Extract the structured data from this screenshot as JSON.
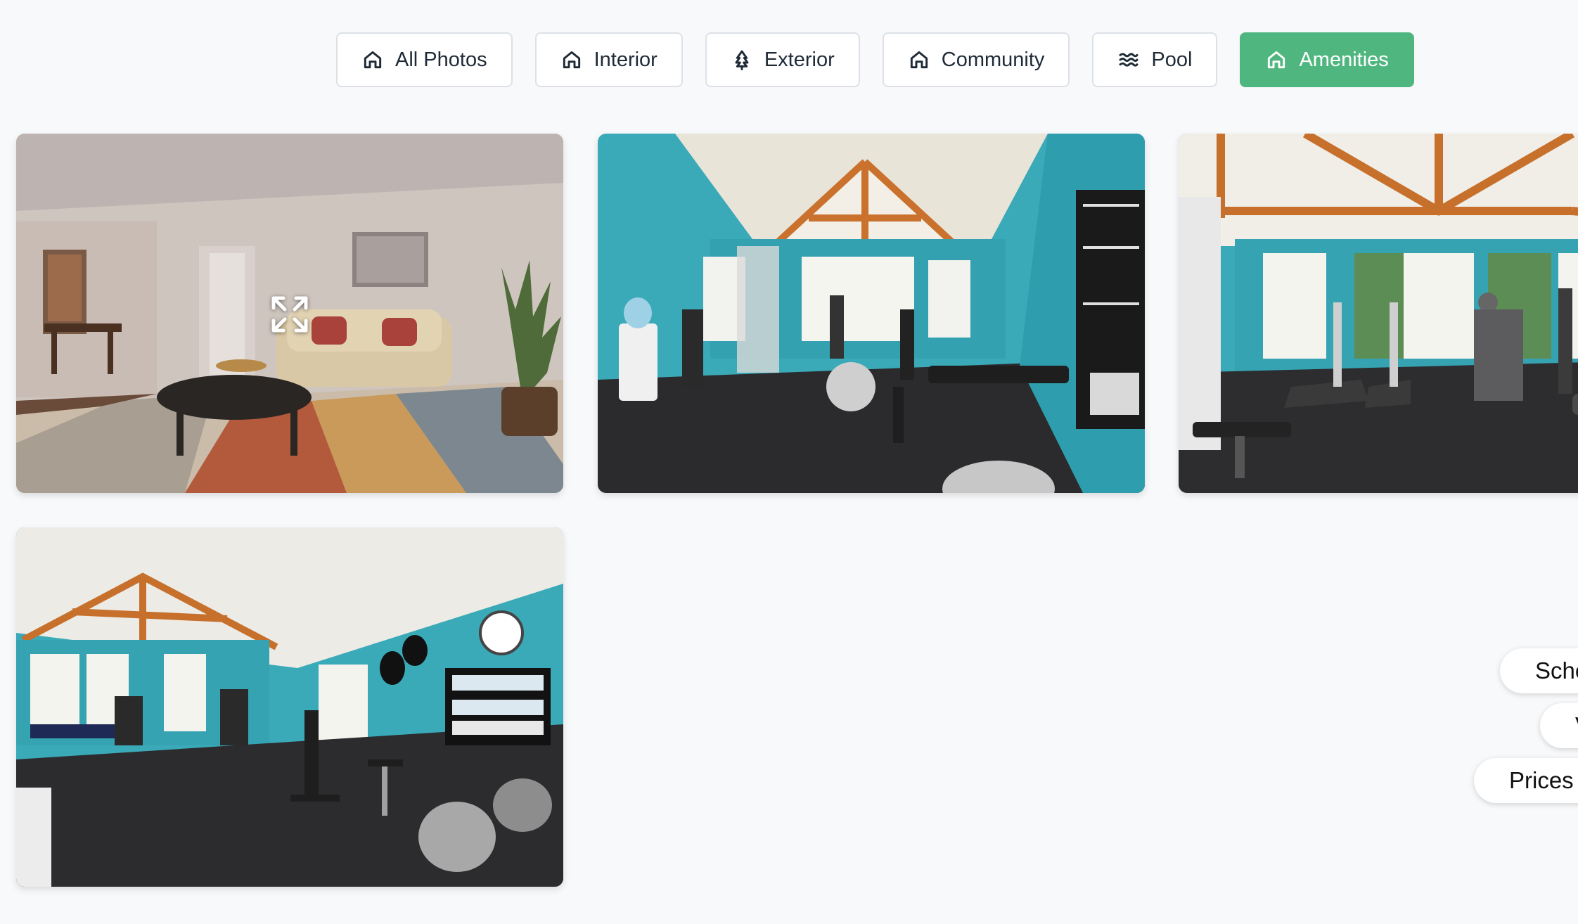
{
  "filters": {
    "tabs": [
      {
        "label": "All Photos",
        "icon": "home-icon",
        "active": false
      },
      {
        "label": "Interior",
        "icon": "home-icon",
        "active": false
      },
      {
        "label": "Exterior",
        "icon": "tree-icon",
        "active": false
      },
      {
        "label": "Community",
        "icon": "home-icon",
        "active": false
      },
      {
        "label": "Pool",
        "icon": "waves-icon",
        "active": false
      },
      {
        "label": "Amenities",
        "icon": "home-icon",
        "active": true
      }
    ]
  },
  "gallery": {
    "photos": [
      {
        "subject": "living-room",
        "has_expand_overlay": true
      },
      {
        "subject": "fitness-center"
      },
      {
        "subject": "fitness-center"
      },
      {
        "subject": "fitness-center"
      }
    ]
  },
  "floating_actions": {
    "schedule_label": "Sche",
    "middle_label": "V",
    "prices_label": "Prices"
  },
  "colors": {
    "background": "#f8f9fb",
    "active_tab": "#4fb67f",
    "gym_wall": "#3aa9b8",
    "tab_border": "#dde1e6"
  }
}
